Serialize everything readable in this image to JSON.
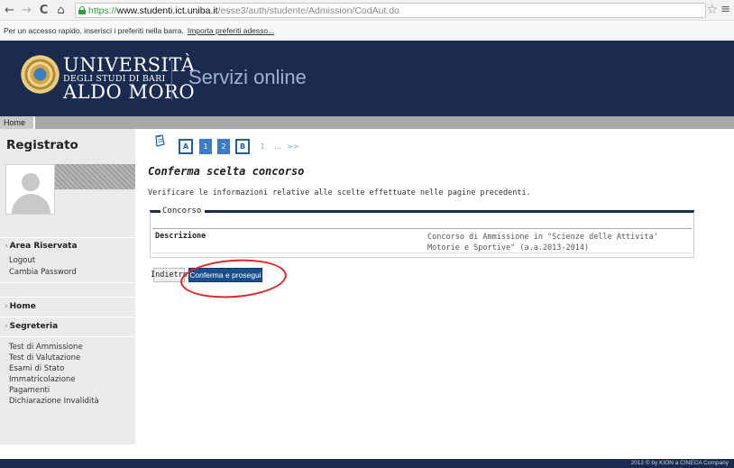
{
  "browser": {
    "back_glyph": "←",
    "forward_glyph": "→",
    "reload_glyph": "C",
    "home_glyph": "⌂",
    "url_scheme": "https://",
    "url_host": "www.studenti.ict.uniba.it",
    "url_path": "/esse3/auth/studente/Admission/CodAut.do",
    "star_glyph": "☆",
    "menu_glyph": "≡",
    "bookmarks_hint": "Per un accesso rapido, inserisci i preferiti nella barra.",
    "bookmarks_link": "Importa preferiti adesso..."
  },
  "header": {
    "logo_line1": "UNIVERSITÀ",
    "logo_line2": "DEGLI STUDI DI BARI",
    "logo_line3": "ALDO MORO",
    "service_title": "Servizi online",
    "background_color": "#1a2b4f"
  },
  "breadcrumb": {
    "home": "Home"
  },
  "sidebar": {
    "title": "Registrato",
    "area_riservata": "Area Riservata",
    "area_links": [
      "Logout",
      "Cambia Password"
    ],
    "home": "Home",
    "segreteria": "Segreteria",
    "segreteria_links": [
      "Test di Ammissione",
      "Test di Valutazione",
      "Esami di Stato",
      "Immatricolazione",
      "Pagamenti",
      "Dichiarazione Invalidità"
    ]
  },
  "wizard": {
    "steps": [
      "A",
      "1",
      "2",
      "B",
      "1",
      "...",
      ">>"
    ]
  },
  "main": {
    "heading": "Conferma scelta concorso",
    "description": "Verificare le informazioni relative alle scelte effettuate nelle pagine precedenti.",
    "fieldset_legend": "Concorso",
    "row_label": "Descrizione",
    "row_value": "Concorso di Ammissione in \"Scienze delle Attivita' Motorie e Sportive\" (a.a.2013-2014)",
    "back_button": "Indietro",
    "confirm_button": "Conferma e prosegui",
    "highlight_color": "#e0252a"
  },
  "footer": {
    "text": "2012 © by KION a CINECA Company"
  }
}
